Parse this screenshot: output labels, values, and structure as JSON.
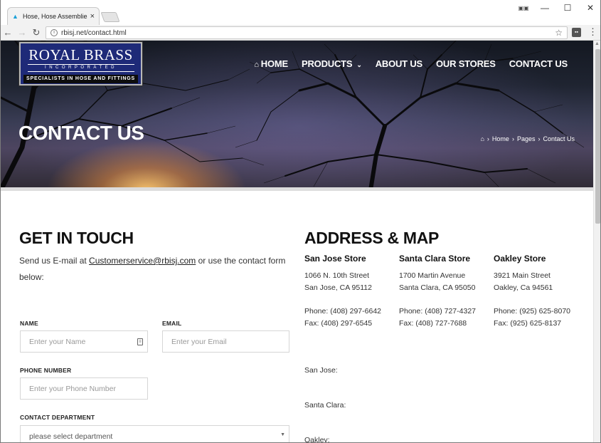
{
  "browser": {
    "tab_title": "Hose, Hose Assemblies, F",
    "tab_close": "×",
    "url": "rbisj.net/contact.html",
    "win_minimize": "—",
    "win_maximize": "☐",
    "win_close": "✕",
    "back": "←",
    "forward": "→",
    "reload": "↻",
    "star": "☆",
    "menu": "⋮"
  },
  "logo": {
    "name": "ROYAL BRASS",
    "incorporated": "INCORPORATED",
    "tagline": "SPECIALISTS IN HOSE AND FITTINGS"
  },
  "nav": {
    "home": "HOME",
    "products": "PRODUCTS",
    "about": "ABOUT US",
    "stores": "OUR STORES",
    "contact": "CONTACT US"
  },
  "hero": {
    "title": "CONTACT US",
    "crumb_home": "Home",
    "crumb_pages": "Pages",
    "crumb_current": "Contact Us"
  },
  "get_in_touch": {
    "heading": "GET IN TOUCH",
    "intro_before": "Send us E-mail at ",
    "email_link": "Customerservice@rbisj.com",
    "intro_after": " or use the contact form below:"
  },
  "form": {
    "name_label": "NAME",
    "name_placeholder": "Enter your Name",
    "email_label": "EMAIL",
    "email_placeholder": "Enter your Email",
    "phone_label": "PHONE NUMBER",
    "phone_placeholder": "Enter your Phone Number",
    "dept_label": "CONTACT DEPARTMENT",
    "dept_selected": "please select department"
  },
  "address": {
    "heading": "ADDRESS & MAP",
    "stores": [
      {
        "name": "San Jose Store",
        "street": "1066 N. 10th Street",
        "city": "San Jose, CA 95112",
        "phone": "Phone: (408) 297-6642",
        "fax": "Fax: (408) 297-6545"
      },
      {
        "name": "Santa Clara Store",
        "street": "1700 Martin Avenue",
        "city": "Santa Clara, CA 95050",
        "phone": "Phone: (408) 727-4327",
        "fax": "Fax: (408) 727-7688"
      },
      {
        "name": "Oakley Store",
        "street": "3921 Main Street",
        "city": "Oakley, Ca 94561",
        "phone": "Phone: (925) 625-8070",
        "fax": "Fax: (925) 625-8137"
      }
    ],
    "map_labels": [
      "San Jose:",
      "Santa Clara:",
      "Oakley:"
    ]
  }
}
